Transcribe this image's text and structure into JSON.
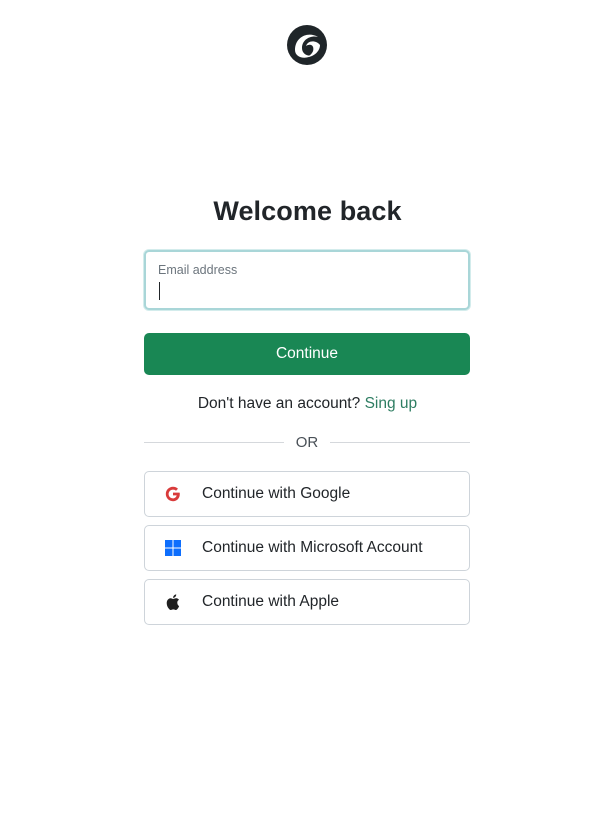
{
  "logo": {
    "icon": "app-logo-icon",
    "color": "#1f2529"
  },
  "title": "Welcome back",
  "email_field": {
    "label": "Email address",
    "value": "",
    "focus_border_color": "#a9d6d8"
  },
  "continue_button": {
    "label": "Continue",
    "color": "#198754"
  },
  "signup": {
    "prompt": "Don't have an account?",
    "link_label": "Sing up",
    "link_color": "#2e7d62"
  },
  "divider": {
    "label": "OR"
  },
  "social_buttons": [
    {
      "id": "google",
      "label": "Continue with Google",
      "icon": "google-icon",
      "icon_color": "#d93b3b"
    },
    {
      "id": "microsoft",
      "label": "Continue with Microsoft Account",
      "icon": "microsoft-icon",
      "icon_color": "#0d6efd"
    },
    {
      "id": "apple",
      "label": "Continue with Apple",
      "icon": "apple-icon",
      "icon_color": "#1f1f1f"
    }
  ]
}
